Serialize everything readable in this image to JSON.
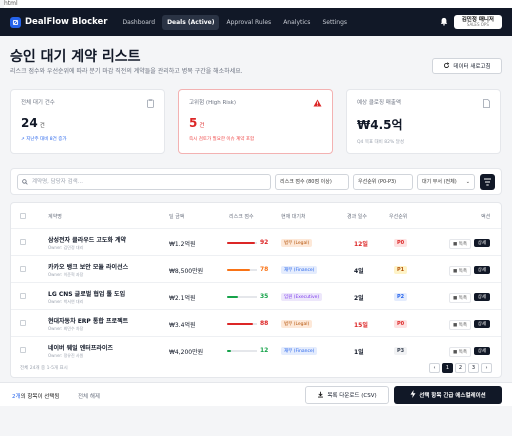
{
  "page_tag": "html",
  "nav": {
    "brand": "DealFlow Blocker",
    "links": [
      "Dashboard",
      "Deals (Active)",
      "Approval Rules",
      "Analytics",
      "Settings"
    ],
    "active_index": 1,
    "user_name": "김민정 매니저",
    "user_role": "SALES OPS"
  },
  "header": {
    "title": "승인 대기 계약 리스트",
    "subtitle": "리스크 점수와 우선순위에 따라 분기 마감 직전의 계약들을 관리하고 병목 구간을 해소하세요.",
    "refresh_label": "데이터 새로고침"
  },
  "cards": [
    {
      "label": "전체 대기 건수",
      "value": "24",
      "unit": "건",
      "note": "지난주 대비 8건 증가",
      "icon": "clipboard-icon"
    },
    {
      "label": "고위험 (High Risk)",
      "value": "5",
      "unit": "건",
      "note": "즉시 검토가 필요한 이슈 계약 포함",
      "icon": "warning-icon"
    },
    {
      "label": "예상 클로징 매출액",
      "value": "₩4.5억",
      "unit": "",
      "note": "Q4 목표 대비 82% 달성",
      "icon": "document-icon"
    }
  ],
  "filters": {
    "search_placeholder": "계약명, 담당자 검색...",
    "risk_select": "리스크 점수 (80점 이상)",
    "priority_select": "우선순위 (P0-P3)",
    "department_select": "대기 부서 (전체)"
  },
  "table": {
    "headers": [
      "계약명",
      "딜 금액",
      "리스크 점수",
      "현재 대기처",
      "경과 일수",
      "우선순위",
      "액션"
    ],
    "rows": [
      {
        "name": "삼성전자 클라우드 고도화 계약",
        "owner": "Owner: 김민정 대리",
        "amount": "₩1.2억원",
        "risk": 92,
        "risk_color": "#dc2626",
        "dept": "법무 (Legal)",
        "dept_bg": "#fde8d8",
        "dept_fg": "#b45309",
        "days": "12일",
        "days_color": "#dc2626",
        "priority": "P0",
        "pri_bg": "#fde2e2",
        "pri_fg": "#dc2626",
        "act_view": "독촉",
        "act_detail": "상세"
      },
      {
        "name": "카카오 뱅크 보안 모듈 라이선스",
        "owner": "Owner: 이준혁 과장",
        "amount": "₩8,500만원",
        "risk": 78,
        "risk_color": "#f97316",
        "dept": "재무 (Finance)",
        "dept_bg": "#e4ecfd",
        "dept_fg": "#2563eb",
        "days": "4일",
        "days_color": "#111827",
        "priority": "P1",
        "pri_bg": "#fef3c7",
        "pri_fg": "#b45309",
        "act_view": "독촉",
        "act_detail": "상세"
      },
      {
        "name": "LG CNS 글로벌 협업 툴 도입",
        "owner": "Owner: 박서연 대리",
        "amount": "₩2.1억원",
        "risk": 35,
        "risk_color": "#16a34a",
        "dept": "임원 (Executive)",
        "dept_bg": "#ede7fb",
        "dept_fg": "#7c3aed",
        "days": "2일",
        "days_color": "#111827",
        "priority": "P2",
        "pri_bg": "#e4ecfd",
        "pri_fg": "#2563eb",
        "act_view": "독촉",
        "act_detail": "상세"
      },
      {
        "name": "현대자동차 ERP 통합 프로젝트",
        "owner": "Owner: 최민수 차장",
        "amount": "₩3.4억원",
        "risk": 88,
        "risk_color": "#dc2626",
        "dept": "법무 (Legal)",
        "dept_bg": "#fde8d8",
        "dept_fg": "#b45309",
        "days": "15일",
        "days_color": "#dc2626",
        "priority": "P0",
        "pri_bg": "#fde2e2",
        "pri_fg": "#dc2626",
        "act_view": "독촉",
        "act_detail": "상세"
      },
      {
        "name": "네이버 웨일 엔터프라이즈",
        "owner": "Owner: 정유진 사원",
        "amount": "₩4,200만원",
        "risk": 12,
        "risk_color": "#16a34a",
        "dept": "재무 (Finance)",
        "dept_bg": "#e4ecfd",
        "dept_fg": "#2563eb",
        "days": "1일",
        "days_color": "#111827",
        "priority": "P3",
        "pri_bg": "#f1f2f4",
        "pri_fg": "#374151",
        "act_view": "독촉",
        "act_detail": "상세"
      }
    ],
    "footer_text": "전체 24개 중 1-5개 표시",
    "pages": [
      "‹",
      "1",
      "2",
      "3",
      "›"
    ],
    "current_page": "1"
  },
  "bottom_bar": {
    "count": "2개",
    "selected_suffix": "의 항목이 선택됨",
    "clear_label": "전체 해제",
    "csv_label": "목록 다운로드 (CSV)",
    "escalate_label": "선택 항목 긴급 에스컬레이션"
  }
}
